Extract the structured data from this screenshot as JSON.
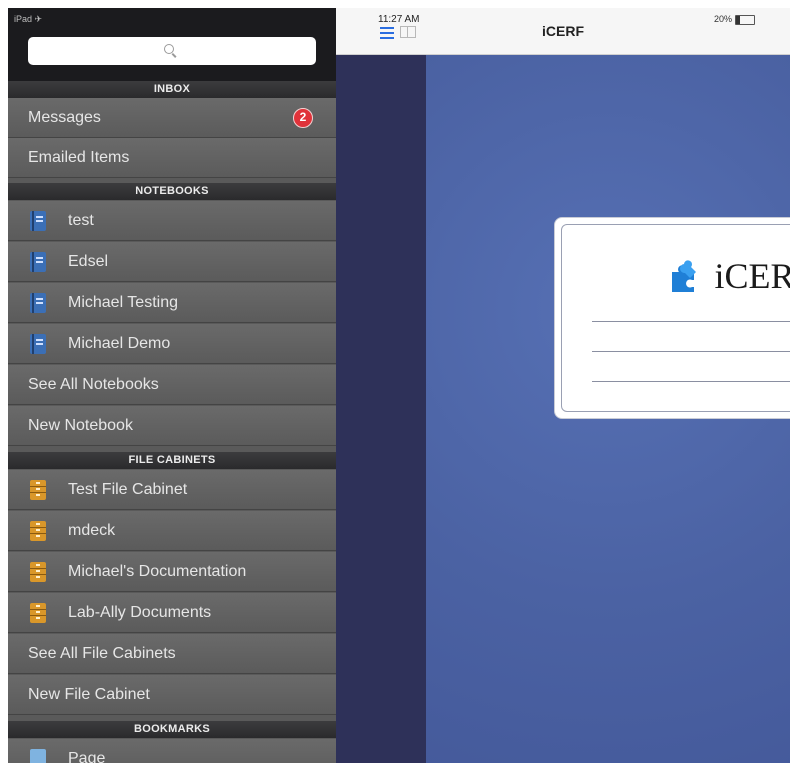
{
  "status": {
    "device": "iPad ✈",
    "time": "11:27 AM",
    "battery": "20%"
  },
  "search": {
    "placeholder": ""
  },
  "sidebar": {
    "inbox_header": "INBOX",
    "inbox": [
      {
        "label": "Messages",
        "badge": "2"
      },
      {
        "label": "Emailed Items"
      }
    ],
    "notebooks_header": "NOTEBOOKS",
    "notebooks": [
      {
        "label": "test",
        "icon": "notebook-icon"
      },
      {
        "label": "Edsel",
        "icon": "notebook-icon"
      },
      {
        "label": "Michael Testing",
        "icon": "notebook-icon"
      },
      {
        "label": "Michael Demo",
        "icon": "notebook-icon"
      }
    ],
    "see_all_notebooks": "See All Notebooks",
    "new_notebook": "New Notebook",
    "cabinets_header": "FILE CABINETS",
    "cabinets": [
      {
        "label": "Test File Cabinet",
        "icon": "file-cabinet-icon"
      },
      {
        "label": "mdeck",
        "icon": "file-cabinet-icon"
      },
      {
        "label": "Michael's Documentation",
        "icon": "file-cabinet-icon"
      },
      {
        "label": "Lab-Ally Documents",
        "icon": "file-cabinet-icon"
      }
    ],
    "see_all_cabinets": "See All File Cabinets",
    "new_cabinet": "New File Cabinet",
    "bookmarks_header": "BOOKMARKS",
    "bookmarks": [
      {
        "label": "Page",
        "icon": "page-icon"
      }
    ]
  },
  "main": {
    "nav_title": "iCERF",
    "logo_text": "iCERF"
  },
  "colors": {
    "sidebar_bg": "#5a5a5a",
    "cover_blue": "#4b61a3",
    "spine": "#2e3159",
    "badge": "#e0323a",
    "accent": "#2a6de0"
  }
}
